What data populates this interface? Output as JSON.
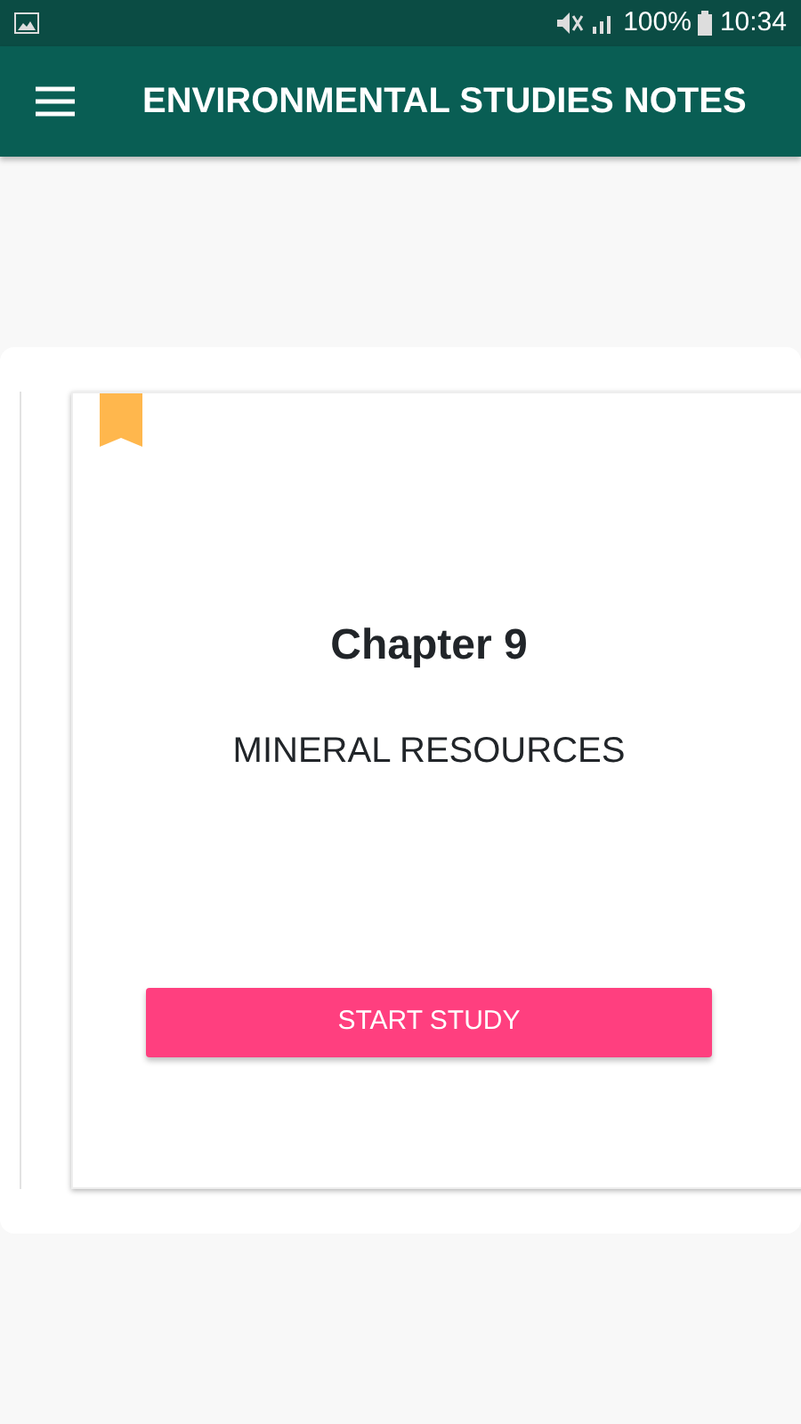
{
  "status_bar": {
    "battery": "100%",
    "time": "10:34"
  },
  "app_bar": {
    "title": "ENVIRONMENTAL STUDIES NOTES"
  },
  "chapter_card": {
    "bookmarked": true,
    "chapter": "Chapter 9",
    "subject": "MINERAL RESOURCES",
    "button": "START STUDY"
  }
}
